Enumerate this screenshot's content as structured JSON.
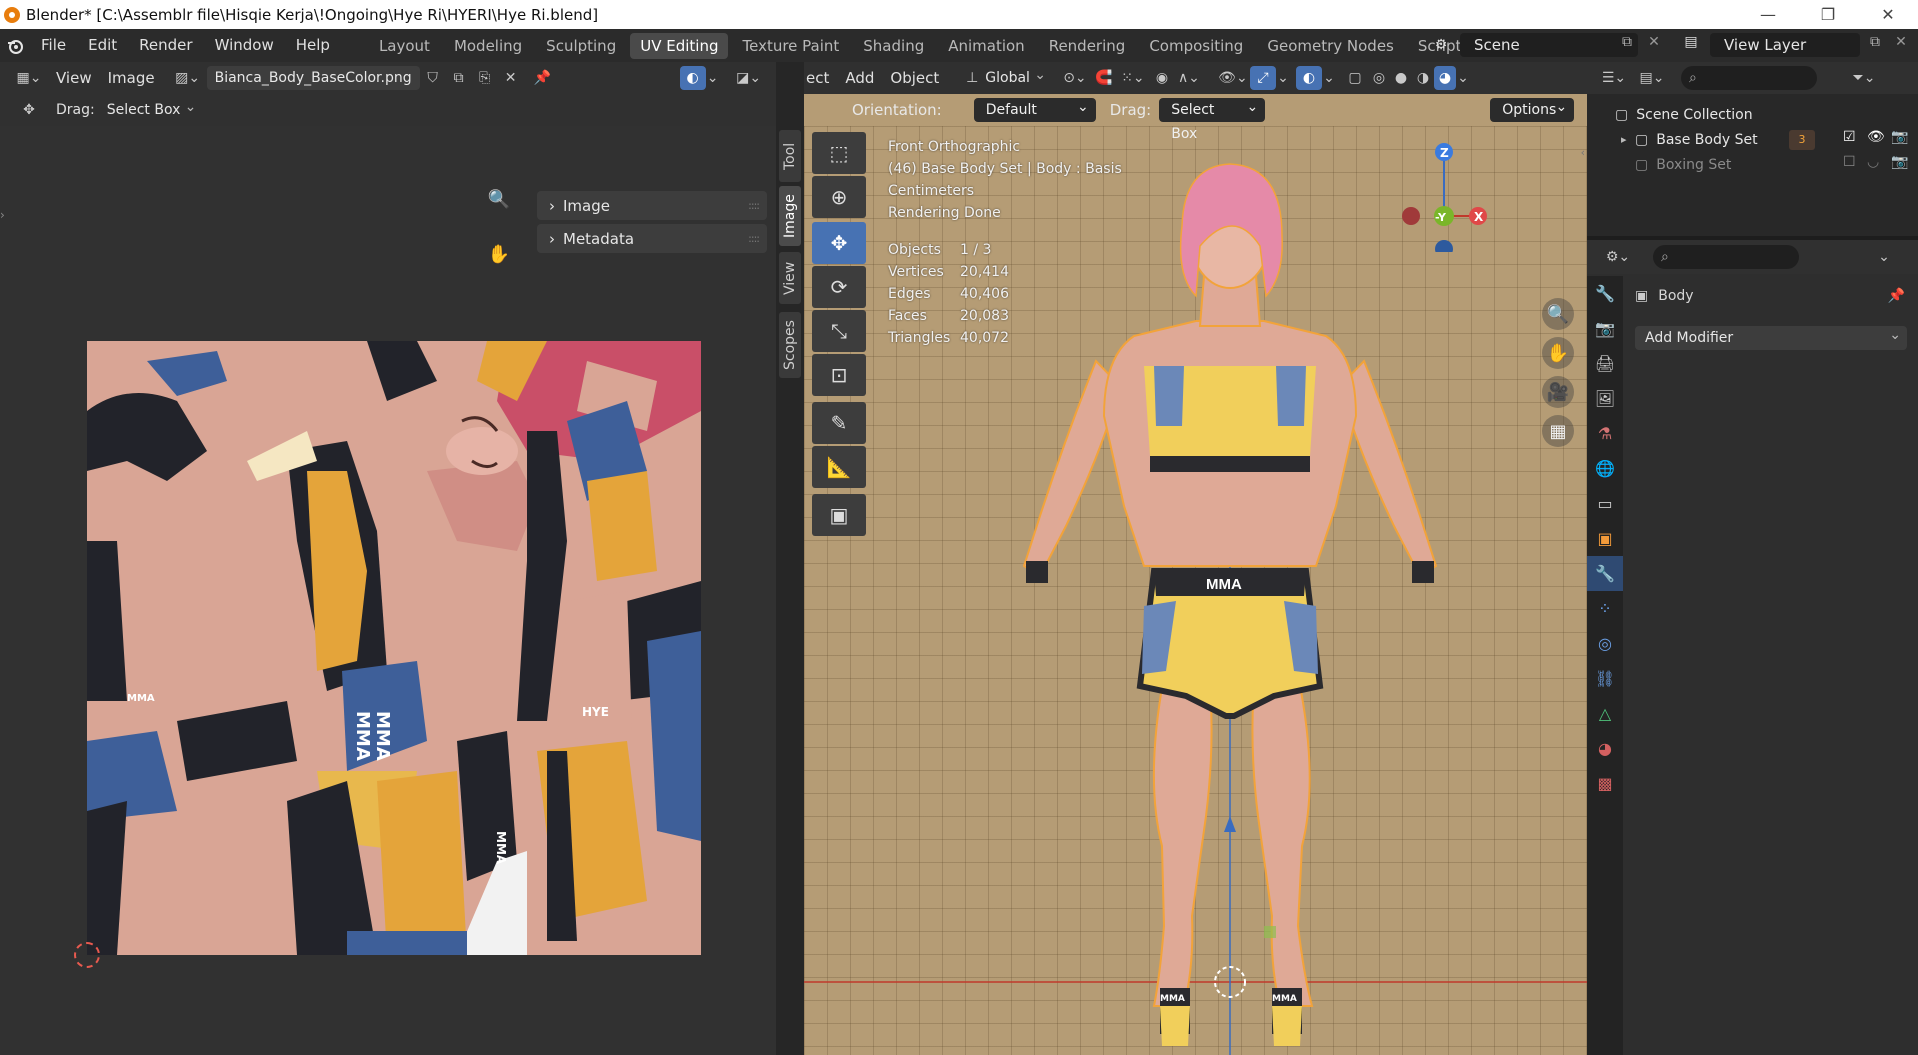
{
  "window": {
    "title": "Blender* [C:\\Assemblr file\\Hisqie Kerja\\!Ongoing\\Hye Ri\\HYERI\\Hye Ri.blend]",
    "minimize": "—",
    "maximize": "❐",
    "close": "✕"
  },
  "menu": [
    "File",
    "Edit",
    "Render",
    "Window",
    "Help"
  ],
  "workspaces": [
    "Layout",
    "Modeling",
    "Sculpting",
    "UV Editing",
    "Texture Paint",
    "Shading",
    "Animation",
    "Rendering",
    "Compositing",
    "Geometry Nodes",
    "Scripting"
  ],
  "active_workspace": "UV Editing",
  "add_workspace": "+",
  "scene": {
    "label": "Scene"
  },
  "view_layer": {
    "label": "View Layer"
  },
  "uv_editor": {
    "view_menu": "View",
    "image_menu": "Image",
    "image_name": "Bianca_Body_BaseColor.png",
    "drag_label": "Drag:",
    "drag_value": "Select Box",
    "npanel": [
      "Image",
      "Metadata"
    ],
    "side_tabs": [
      "Tool",
      "Image",
      "View",
      "Scopes"
    ]
  },
  "viewport": {
    "menus": [
      "ect",
      "Add",
      "Object"
    ],
    "transform_orientation": "Global",
    "orientation_label": "Orientation:",
    "orientation_value": "Default",
    "drag_label": "Drag:",
    "drag_value": "Select Box",
    "options": "Options",
    "info": {
      "view": "Front Orthographic",
      "object": "(46) Base Body Set | Body : Basis",
      "units": "Centimeters",
      "status": "Rendering Done"
    },
    "stats": [
      {
        "label": "Objects",
        "value": "1 / 3"
      },
      {
        "label": "Vertices",
        "value": "20,414"
      },
      {
        "label": "Edges",
        "value": "40,406"
      },
      {
        "label": "Faces",
        "value": "20,083"
      },
      {
        "label": "Triangles",
        "value": "40,072"
      }
    ],
    "gizmo": {
      "z": "Z",
      "y": "-Y",
      "x": "X"
    },
    "model_text": {
      "chest": "MMA",
      "left_sock": "MMA",
      "right_sock": "MMA"
    }
  },
  "outliner": {
    "root": "Scene Collection",
    "items": [
      {
        "label": "Base Body Set",
        "badge": "3"
      },
      {
        "label": "Boxing Set"
      }
    ]
  },
  "properties": {
    "object_name": "Body",
    "add_modifier": "Add Modifier"
  },
  "texture_labels": [
    "MMA",
    "MMA",
    "HYE",
    "MMA",
    "MMA"
  ],
  "colors": {
    "accent": "#4772b3",
    "viewport_bg": "#b59c75",
    "selection_outline": "#f2a33a",
    "hair": "#e58aa8",
    "outfit_yellow": "#f1cf5b",
    "outfit_blue": "#6b88b8"
  }
}
